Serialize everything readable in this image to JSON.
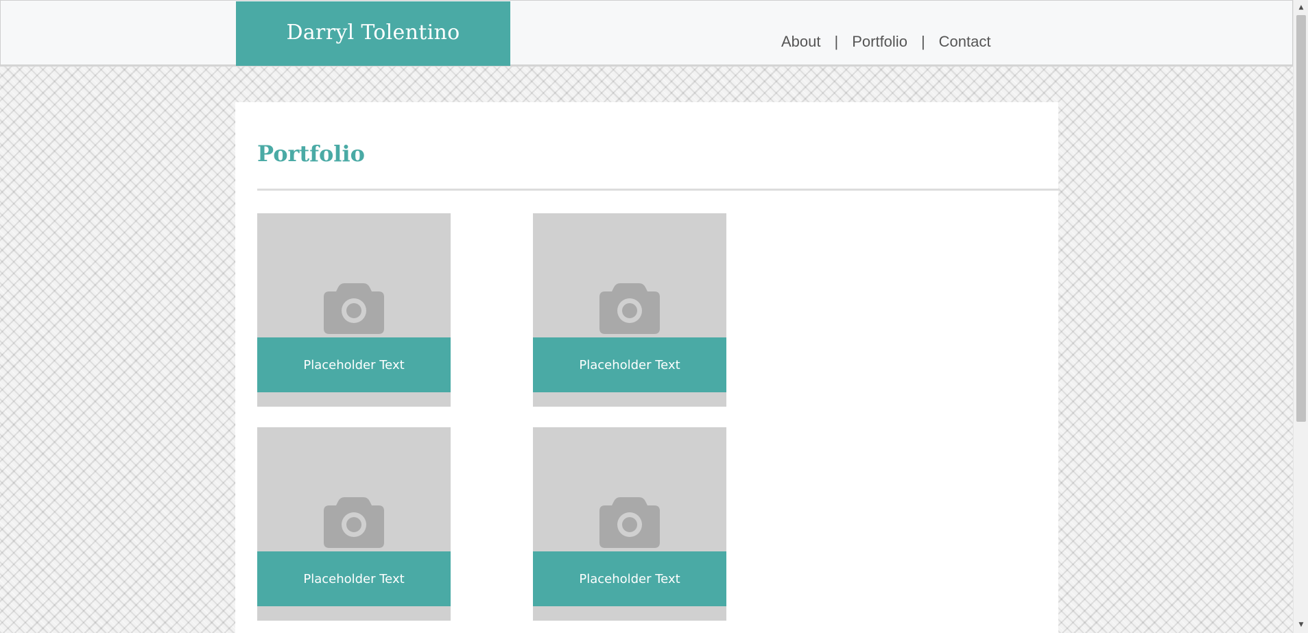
{
  "header": {
    "brand": "Darryl Tolentino",
    "nav": [
      {
        "label": "About"
      },
      {
        "label": "Portfolio"
      },
      {
        "label": "Contact"
      }
    ],
    "separator": "|"
  },
  "main": {
    "title": "Portfolio",
    "cards": [
      {
        "caption": "Placeholder Text",
        "icon": "camera-icon"
      },
      {
        "caption": "Placeholder Text",
        "icon": "camera-icon"
      },
      {
        "caption": "Placeholder Text",
        "icon": "camera-icon"
      },
      {
        "caption": "Placeholder Text",
        "icon": "camera-icon"
      }
    ]
  },
  "scrollbar": {
    "up_glyph": "▲",
    "down_glyph": "▼"
  },
  "colors": {
    "accent": "#4aaaa5",
    "card_bg": "#d0d0d0",
    "icon": "#a9a9a9",
    "header_bg": "#f7f8f9",
    "nav_text": "#555555"
  }
}
